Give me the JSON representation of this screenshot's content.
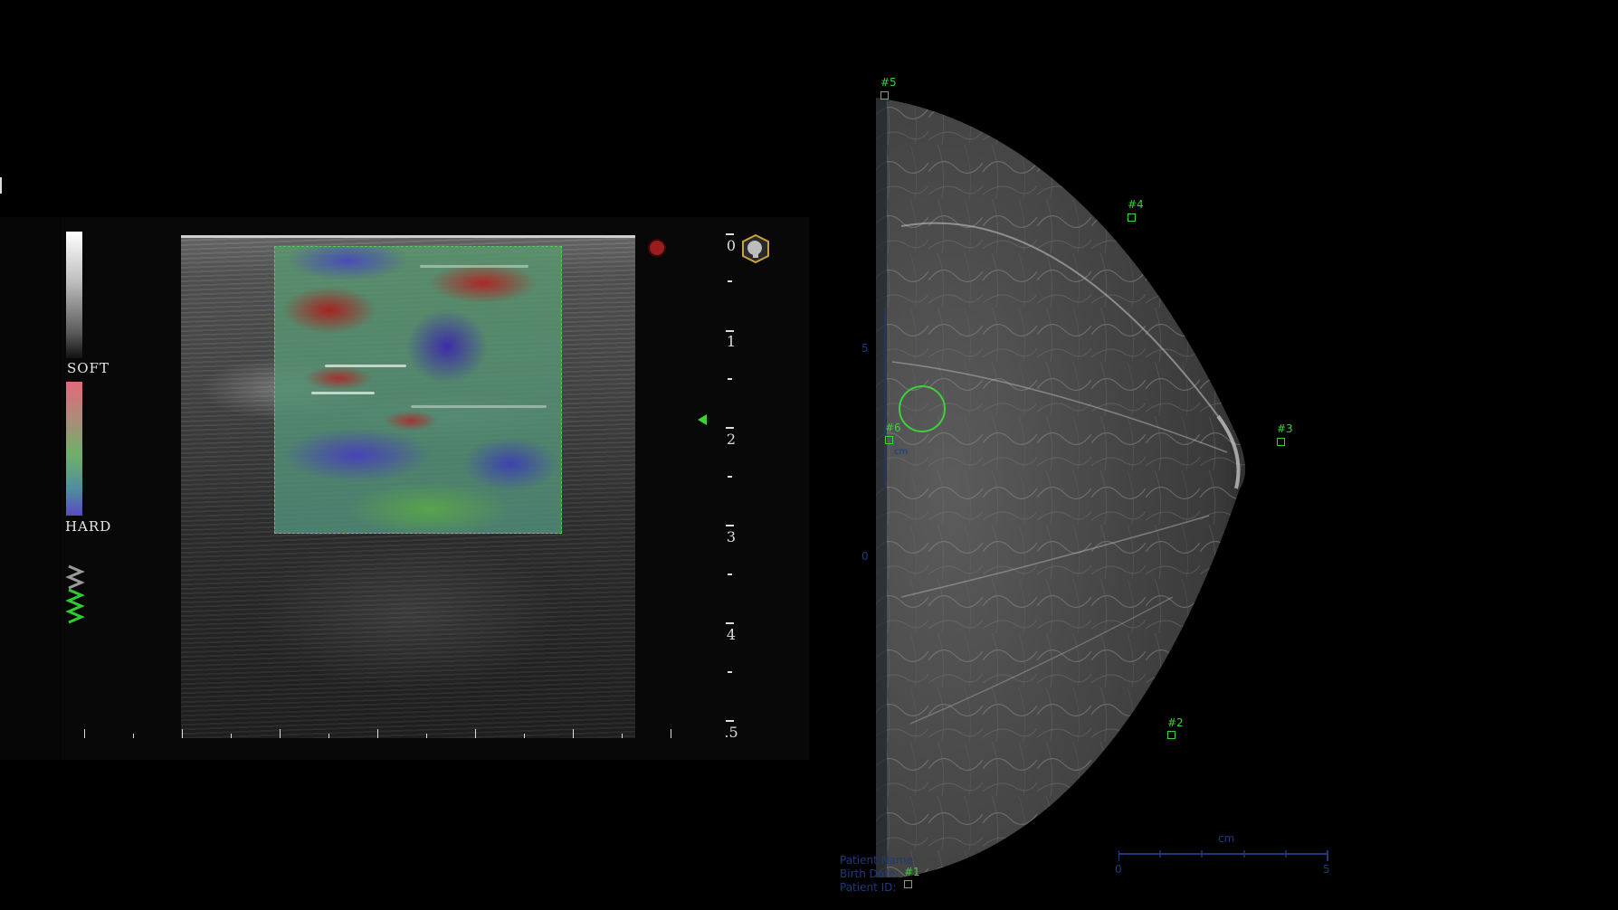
{
  "elastography": {
    "soft_label": "SOFT",
    "hard_label": "HARD",
    "depth_labels": [
      "0",
      "1",
      "2",
      "3",
      "4",
      ".5"
    ]
  },
  "mammogram": {
    "markers": [
      "#5",
      "#4",
      "#6",
      "#3",
      "#2",
      "#1"
    ],
    "side_scale_top": "5",
    "side_scale_bottom": "0",
    "side_scale_unit": "cm",
    "scale_unit": "cm",
    "scale_start": "0",
    "scale_end": "5",
    "overlay_fields": [
      "Patient Name:",
      "Birth Date:",
      "Patient ID:"
    ]
  }
}
